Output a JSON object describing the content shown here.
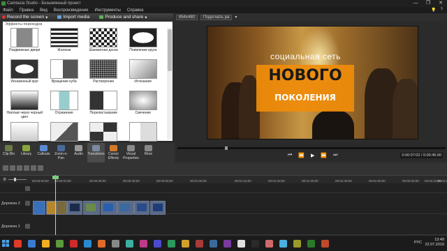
{
  "window": {
    "title": "Camtasia Studio - Безымянный проект"
  },
  "window_buttons": [
    "—",
    "❐",
    "✕"
  ],
  "menu": [
    "Файл",
    "Правка",
    "Вид",
    "Воспроизведение",
    "Инструменты",
    "Справка"
  ],
  "toolbar": {
    "record": "Record the screen",
    "import": "Import media",
    "produce": "Produce and share"
  },
  "preview_top": {
    "size": "854x480",
    "fit": "Подогнать ра"
  },
  "panel": {
    "title": "Эффекты переходов",
    "items": [
      {
        "label": "Раздвижные двери",
        "icon": "doors-icon"
      },
      {
        "label": "Жалюзи",
        "icon": "blinds-icon"
      },
      {
        "label": "Шахматная доска",
        "icon": "checkerboard-icon"
      },
      {
        "label": "Появление круга",
        "icon": "circle-in-icon"
      },
      {
        "label": "Искаженный круг",
        "icon": "distorted-circle-icon"
      },
      {
        "label": "Вращение куба",
        "icon": "cube-rotate-icon"
      },
      {
        "label": "Растворение",
        "icon": "dissolve-icon"
      },
      {
        "label": "Исчезание",
        "icon": "fade-icon"
      },
      {
        "label": "Наплыв через черный цвет",
        "icon": "fade-black-icon"
      },
      {
        "label": "Отражение",
        "icon": "reflection-icon"
      },
      {
        "label": "Перелистывание",
        "icon": "page-turn-icon"
      },
      {
        "label": "Свечение",
        "icon": "glow-icon"
      },
      {
        "label": "",
        "icon": "slide-arrow-icon"
      },
      {
        "label": "",
        "icon": "diagonal-icon"
      },
      {
        "label": "",
        "icon": "arrows-in-icon"
      },
      {
        "label": "",
        "icon": "page-curl-icon"
      }
    ]
  },
  "video": {
    "slogan": "социальная сеть",
    "big": "НОВОГО",
    "sub": "ПОКОЛЕНИЯ"
  },
  "player": {
    "timecode": "0:00:07:02 / 0:00:45:00",
    "buttons": [
      "⏮",
      "⏪",
      "▶",
      "⏩",
      "⏭"
    ]
  },
  "tools": [
    {
      "label": "Clip Bin",
      "icon": "clip-bin-icon",
      "color": "#6c7a4a"
    },
    {
      "label": "Library",
      "icon": "library-icon",
      "color": "#8aa63a"
    },
    {
      "label": "Callouts",
      "icon": "callouts-icon",
      "color": "#5a8ad0"
    },
    {
      "label": "Zoom-n-Pan",
      "icon": "zoom-pan-icon",
      "color": "#4a6a9a"
    },
    {
      "label": "Audio",
      "icon": "audio-icon",
      "color": "#9a9a9a"
    },
    {
      "label": "Transitions",
      "icon": "transitions-icon",
      "color": "#7a8aa0"
    },
    {
      "label": "Cursor Effects",
      "icon": "cursor-effects-icon",
      "color": "#d07a2a"
    },
    {
      "label": "Visual Properties",
      "icon": "visual-properties-icon",
      "color": "#8a8a8a"
    },
    {
      "label": "More",
      "icon": "more-icon",
      "color": "#888888"
    }
  ],
  "ruler": [
    "00:00:00;00",
    "00:00:02;00",
    "00:00:30;00",
    "00:00:40;00",
    "00:00:50;00",
    "00:01:00;00",
    "00:01:10;00",
    "00:01:20;00",
    "00:01:30;00",
    "00:01:40;00",
    "00:01:50;00",
    "00:02:00;00",
    "00:02:10;00",
    "00:02:20;00"
  ],
  "tracks": [
    "Дорожка 2",
    "Дорожка 1"
  ],
  "taskbar": {
    "time": "13:49",
    "date": "22.07.2019",
    "lang": "РУС"
  }
}
